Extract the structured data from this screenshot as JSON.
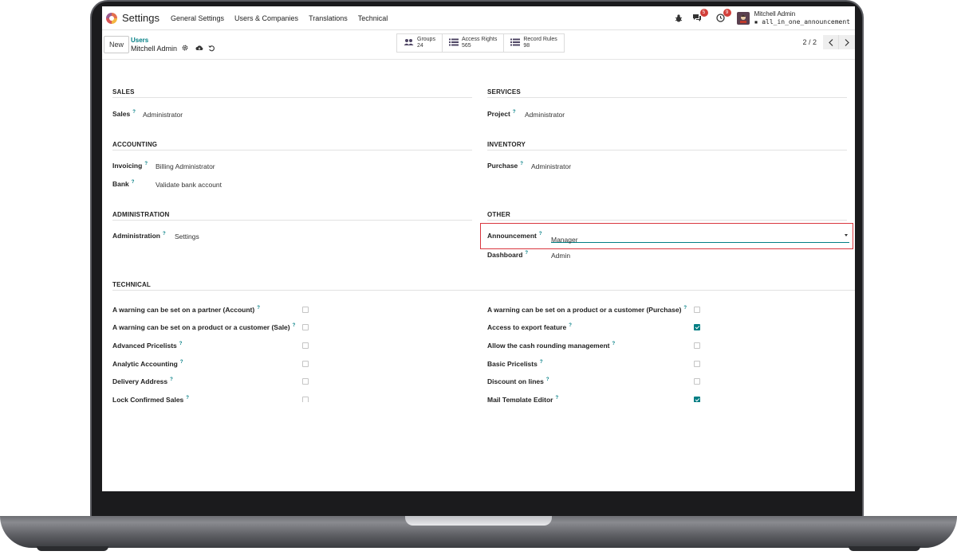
{
  "navbar": {
    "app_title": "Settings",
    "menu": [
      "General Settings",
      "Users & Companies",
      "Translations",
      "Technical"
    ],
    "messages_badge": "5",
    "activity_badge": "9",
    "user_name": "Mitchell Admin",
    "database": "all_in_one_announcement"
  },
  "control": {
    "new_label": "New",
    "breadcrumb_parent": "Users",
    "breadcrumb_current": "Mitchell Admin",
    "smart_buttons": [
      {
        "label": "Groups",
        "count": "24"
      },
      {
        "label": "Access Rights",
        "count": "565"
      },
      {
        "label": "Record Rules",
        "count": "98"
      }
    ],
    "pager": "2 / 2"
  },
  "form": {
    "sales": {
      "title": "SALES",
      "fields": [
        {
          "label": "Sales",
          "value": "Administrator"
        }
      ]
    },
    "services": {
      "title": "SERVICES",
      "fields": [
        {
          "label": "Project",
          "value": "Administrator"
        }
      ]
    },
    "accounting": {
      "title": "ACCOUNTING",
      "fields": [
        {
          "label": "Invoicing",
          "value": "Billing Administrator"
        },
        {
          "label": "Bank",
          "value": "Validate bank account"
        }
      ]
    },
    "inventory": {
      "title": "INVENTORY",
      "fields": [
        {
          "label": "Purchase",
          "value": "Administrator"
        }
      ]
    },
    "administration": {
      "title": "ADMINISTRATION",
      "fields": [
        {
          "label": "Administration",
          "value": "Settings"
        }
      ]
    },
    "other": {
      "title": "OTHER",
      "fields": [
        {
          "label": "Announcement",
          "value": "Manager"
        },
        {
          "label": "Dashboard",
          "value": "Admin"
        }
      ]
    },
    "technical": {
      "title": "TECHNICAL",
      "left": [
        {
          "label": "A warning can be set on a partner (Account)",
          "checked": false
        },
        {
          "label": "A warning can be set on a product or a customer (Sale)",
          "checked": false
        },
        {
          "label": "Advanced Pricelists",
          "checked": false
        },
        {
          "label": "Analytic Accounting",
          "checked": false
        },
        {
          "label": "Delivery Address",
          "checked": false
        },
        {
          "label": "Lock Confirmed Sales",
          "checked": false
        }
      ],
      "right": [
        {
          "label": "A warning can be set on a product or a customer (Purchase)",
          "checked": false
        },
        {
          "label": "Access to export feature",
          "checked": true
        },
        {
          "label": "Allow the cash rounding management",
          "checked": false
        },
        {
          "label": "Basic Pricelists",
          "checked": false
        },
        {
          "label": "Discount on lines",
          "checked": false
        },
        {
          "label": "Mail Template Editor",
          "checked": true
        }
      ]
    },
    "help_marker": "?"
  },
  "colors": {
    "accent": "#017e84",
    "highlight": "#d9363e",
    "badge": "#d23f3a"
  }
}
